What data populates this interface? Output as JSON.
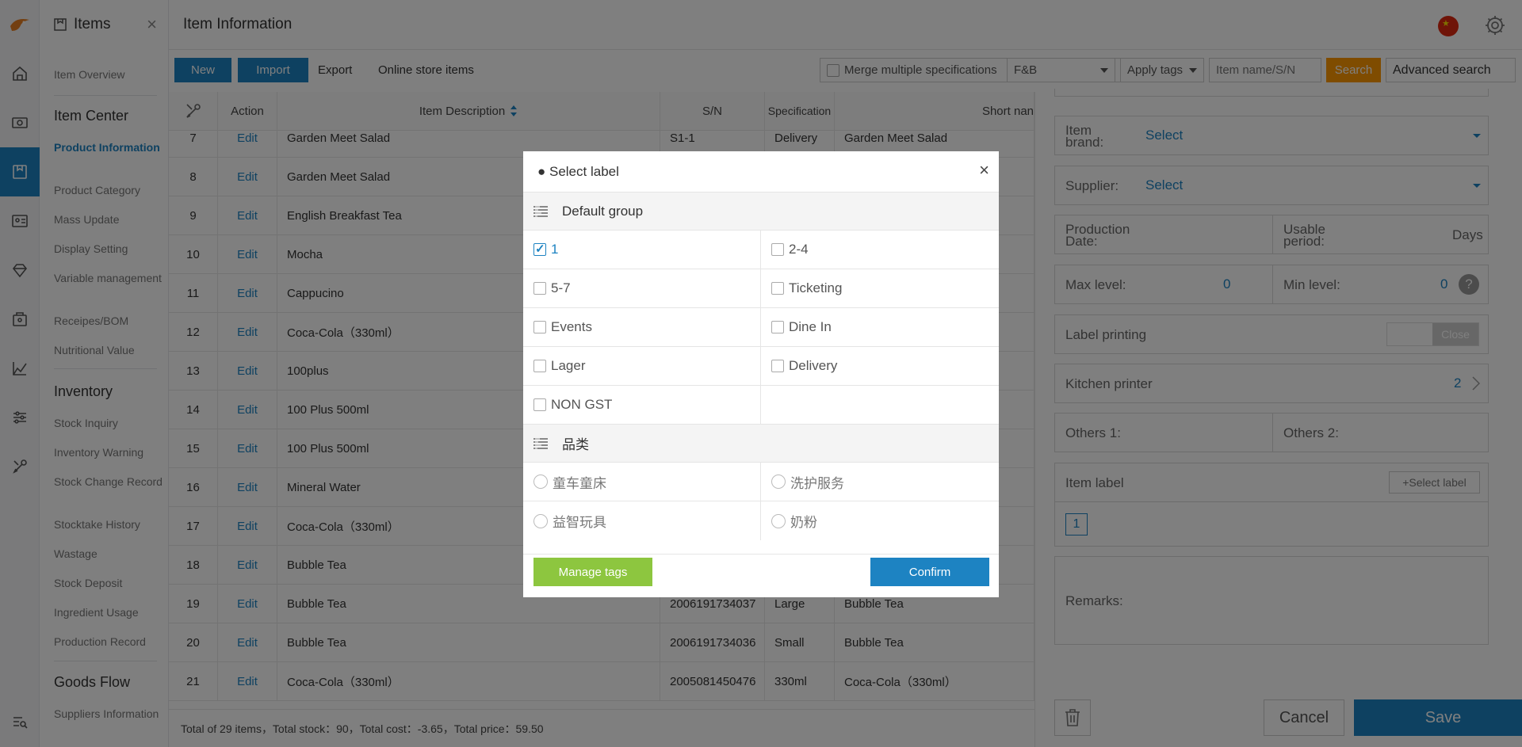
{
  "nav": {
    "section_title": "Items",
    "close_glyph": "×",
    "item_overview": "Item Overview",
    "item_center": "Item Center",
    "product_information": "Product Information",
    "product_category": "Product Category",
    "mass_update": "Mass Update",
    "display_setting": "Display Setting",
    "variable_management": "Variable management",
    "receipes_bom": "Receipes/BOM",
    "nutritional_value": "Nutritional Value",
    "inventory": "Inventory",
    "stock_inquiry": "Stock Inquiry",
    "inventory_warning": "Inventory Warning",
    "stock_change_record": "Stock Change Record",
    "stocktake_history": "Stocktake History",
    "wastage": "Wastage",
    "stock_deposit": "Stock Deposit",
    "ingredient_usage": "Ingredient Usage",
    "production_record": "Production Record",
    "goods_flow": "Goods Flow",
    "suppliers_information": "Suppliers Information"
  },
  "header": {
    "title": "Item Information"
  },
  "toolbar": {
    "new": "New",
    "import": "Import",
    "export": "Export",
    "online_store_items": "Online store items",
    "merge_specs": "Merge multiple specifications",
    "category_select": "F&B",
    "apply_tags": "Apply tags",
    "search_placeholder": "Item name/S/N",
    "search": "Search",
    "advanced_search": "Advanced search"
  },
  "table": {
    "columns": {
      "action": "Action",
      "description": "Item Description",
      "sn": "S/N",
      "specification": "Specification",
      "short_name": "Short nan"
    },
    "rows": [
      {
        "no": "7",
        "action": "Edit",
        "desc": "Garden Meet Salad",
        "sn": "S1-1",
        "spec": "Delivery",
        "short": "Garden Meet Salad"
      },
      {
        "no": "8",
        "action": "Edit",
        "desc": "Garden Meet Salad",
        "sn": "",
        "spec": "",
        "short": ""
      },
      {
        "no": "9",
        "action": "Edit",
        "desc": "English Breakfast Tea",
        "sn": "",
        "spec": "",
        "short": ""
      },
      {
        "no": "10",
        "action": "Edit",
        "desc": "Mocha",
        "sn": "",
        "spec": "",
        "short": ""
      },
      {
        "no": "11",
        "action": "Edit",
        "desc": "Cappucino",
        "sn": "",
        "spec": "",
        "short": ""
      },
      {
        "no": "12",
        "action": "Edit",
        "desc": "Coca-Cola（330ml）",
        "sn": "",
        "spec": "",
        "short": ""
      },
      {
        "no": "13",
        "action": "Edit",
        "desc": "100plus",
        "sn": "",
        "spec": "",
        "short": ""
      },
      {
        "no": "14",
        "action": "Edit",
        "desc": "100 Plus 500ml",
        "sn": "",
        "spec": "",
        "short": ""
      },
      {
        "no": "15",
        "action": "Edit",
        "desc": "100 Plus 500ml",
        "sn": "",
        "spec": "",
        "short": ""
      },
      {
        "no": "16",
        "action": "Edit",
        "desc": "Mineral Water",
        "sn": "",
        "spec": "",
        "short": ""
      },
      {
        "no": "17",
        "action": "Edit",
        "desc": "Coca-Cola（330ml）",
        "sn": "",
        "spec": "",
        "short": ""
      },
      {
        "no": "18",
        "action": "Edit",
        "desc": "Bubble Tea",
        "sn": "",
        "spec": "",
        "short": ""
      },
      {
        "no": "19",
        "action": "Edit",
        "desc": "Bubble Tea",
        "sn": "2006191734037",
        "spec": "Large",
        "short": "Bubble Tea"
      },
      {
        "no": "20",
        "action": "Edit",
        "desc": "Bubble Tea",
        "sn": "2006191734036",
        "spec": "Small",
        "short": "Bubble Tea"
      },
      {
        "no": "21",
        "action": "Edit",
        "desc": "Coca-Cola（330ml）",
        "sn": "2005081450476",
        "spec": "330ml",
        "short": "Coca-Cola（330ml）"
      }
    ],
    "footer": "Total of 29 items，Total stock：90，Total cost：-3.65，Total price：59.50"
  },
  "form": {
    "item_brand_label": "Item brand:",
    "item_brand_value": "Select",
    "supplier_label": "Supplier:",
    "supplier_value": "Select",
    "production_date_label": "Production Date:",
    "usable_period_label": "Usable period:",
    "usable_period_unit": "Days",
    "max_level_label": "Max level:",
    "max_level_value": "0",
    "min_level_label": "Min level:",
    "min_level_value": "0",
    "help_glyph": "?",
    "label_printing_label": "Label printing",
    "label_printing_state": "Close",
    "kitchen_printer_label": "Kitchen printer",
    "kitchen_printer_value": "2",
    "others1_label": "Others 1:",
    "others2_label": "Others 2:",
    "item_label_label": "Item label",
    "select_label_button": "+Select label",
    "selected_tag": "1",
    "remarks_label": "Remarks:",
    "cancel": "Cancel",
    "save": "Save"
  },
  "modal": {
    "title": "● Select label",
    "close_glyph": "×",
    "group1_name": "Default group",
    "group1_options": [
      {
        "label": "1",
        "checked": true
      },
      {
        "label": "2-4",
        "checked": false
      },
      {
        "label": "5-7",
        "checked": false
      },
      {
        "label": "Ticketing",
        "checked": false
      },
      {
        "label": "Events",
        "checked": false
      },
      {
        "label": "Dine In",
        "checked": false
      },
      {
        "label": "Lager",
        "checked": false
      },
      {
        "label": "Delivery",
        "checked": false
      },
      {
        "label": "NON GST",
        "checked": false
      }
    ],
    "group2_name": "品类",
    "group2_options": [
      {
        "label": "童车童床"
      },
      {
        "label": "洗护服务"
      },
      {
        "label": "益智玩具"
      },
      {
        "label": "奶粉"
      }
    ],
    "manage_tags": "Manage tags",
    "confirm": "Confirm"
  },
  "colors": {
    "primary": "#1d83c2",
    "search": "#ff9900",
    "manage": "#8dc63f",
    "flag": "#de2910"
  }
}
